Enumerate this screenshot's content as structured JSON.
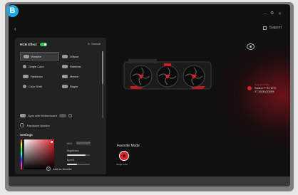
{
  "badge": "B",
  "window": {
    "minimize": "–",
    "maximize": "⧉",
    "close": "✕",
    "back": "‹",
    "support": "Support"
  },
  "rgb": {
    "title": "RGB Effect",
    "enabled": true,
    "default_label": "Default",
    "effects": [
      {
        "label": "Breathe",
        "icon": "breathe-icon",
        "selected": true
      },
      {
        "label": "Diffuse",
        "icon": "diffuse-icon",
        "selected": false
      },
      {
        "label": "Single Color",
        "icon": "single-color-icon",
        "selected": false
      },
      {
        "label": "Rainbow",
        "icon": "rainbow-icon",
        "selected": false
      },
      {
        "label": "Radiance",
        "icon": "radiance-icon",
        "selected": false
      },
      {
        "label": "Meteor",
        "icon": "meteor-icon",
        "selected": false
      },
      {
        "label": "Color Shift",
        "icon": "color-shift-icon",
        "selected": false
      },
      {
        "label": "Ripple",
        "icon": "ripple-icon",
        "selected": false
      }
    ],
    "sync_label": "Sync with Motherboard",
    "hardware_label": "Hardware Monitor"
  },
  "settings": {
    "title": "Settings",
    "hex_label": "HEX",
    "brightness_label": "Brightness",
    "brightness": 0.8,
    "speed_label": "Speed",
    "speed": 0.45,
    "add_favorite": "Add as favorite"
  },
  "device": {
    "label": "Overclock GPU",
    "name_line1": "Radeon™ RX 9070",
    "name_line2": "XT 16GB GDDR6"
  },
  "favorites": {
    "title": "Favorite Mode",
    "item_label": "Single Color"
  },
  "colors": {
    "accent": "#d8232a",
    "toggle_on": "#36c24e",
    "badge": "#1ea7e0"
  }
}
